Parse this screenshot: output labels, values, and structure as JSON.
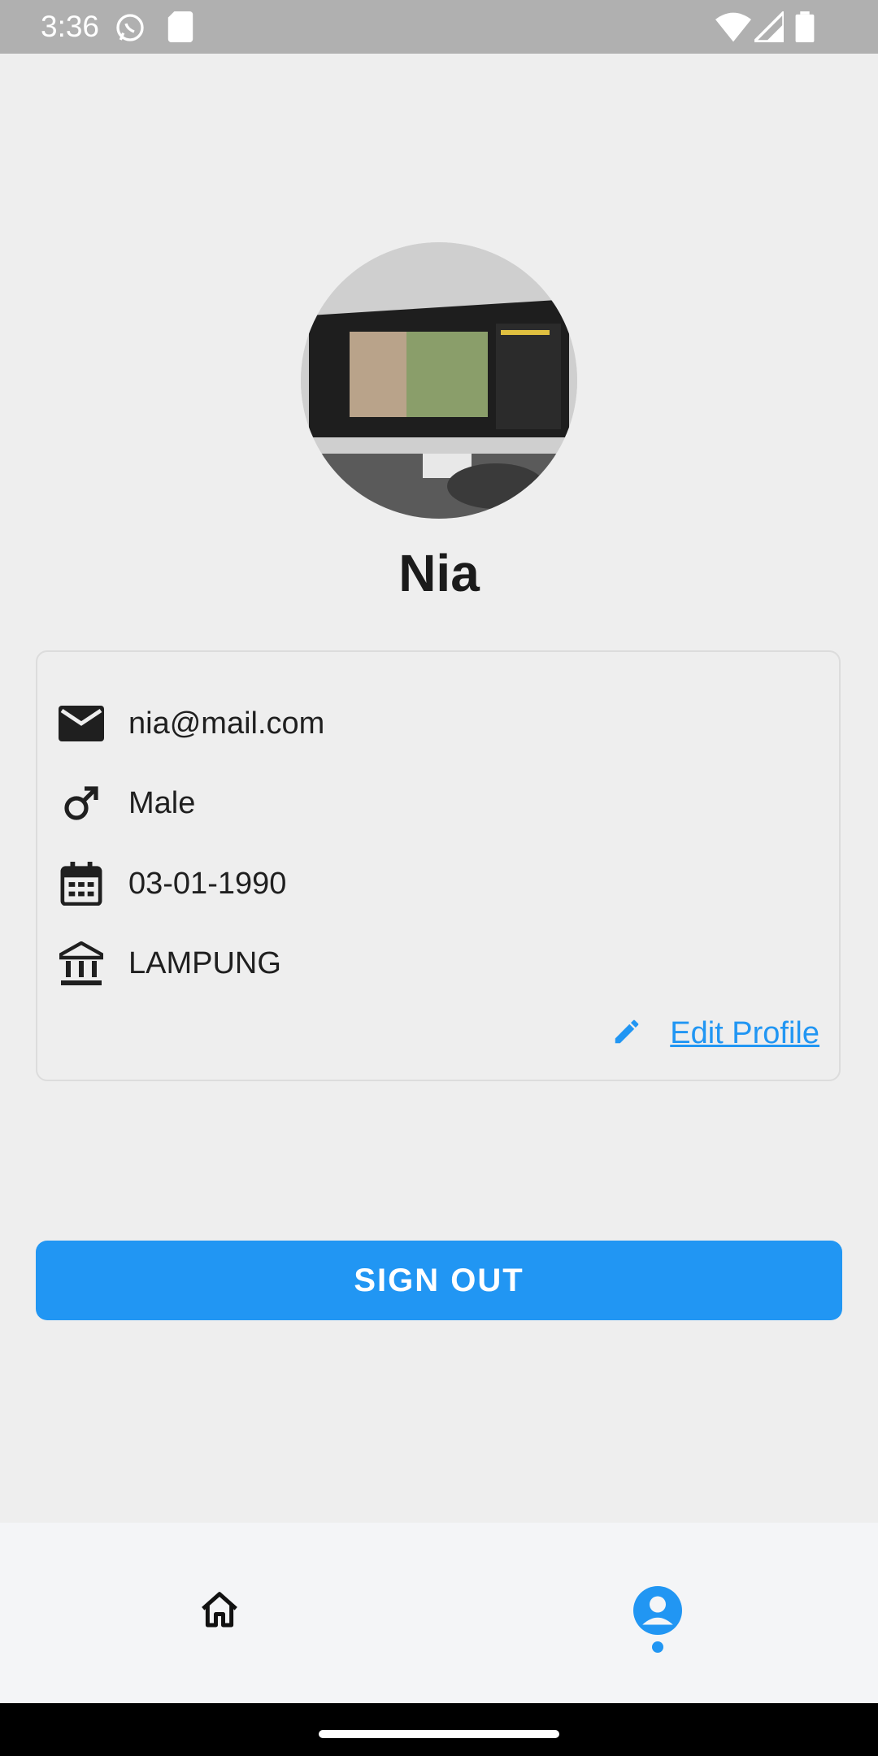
{
  "status_bar": {
    "time": "3:36",
    "icons": [
      "whatsapp-icon",
      "sd-card-icon",
      "wifi-icon",
      "cellular-signal-icon",
      "battery-icon"
    ]
  },
  "profile": {
    "avatar": "profile-photo",
    "name": "Nia"
  },
  "details": {
    "email": {
      "icon": "email-icon",
      "value": "nia@mail.com"
    },
    "gender": {
      "icon": "male-icon",
      "value": "Male"
    },
    "birthdate": {
      "icon": "calendar-icon",
      "value": "03-01-1990"
    },
    "province": {
      "icon": "institution-icon",
      "value": "LAMPUNG"
    },
    "edit_label": "Edit Profile"
  },
  "actions": {
    "sign_out_label": "SIGN OUT"
  },
  "bottom_nav": {
    "items": [
      {
        "icon": "home-icon",
        "active": false
      },
      {
        "icon": "account-circle-icon",
        "active": true
      }
    ]
  },
  "colors": {
    "accent": "#2196f3",
    "background": "#eeeeee",
    "status_bar": "#b0b0b0",
    "bottom_nav": "#f4f5f7"
  }
}
